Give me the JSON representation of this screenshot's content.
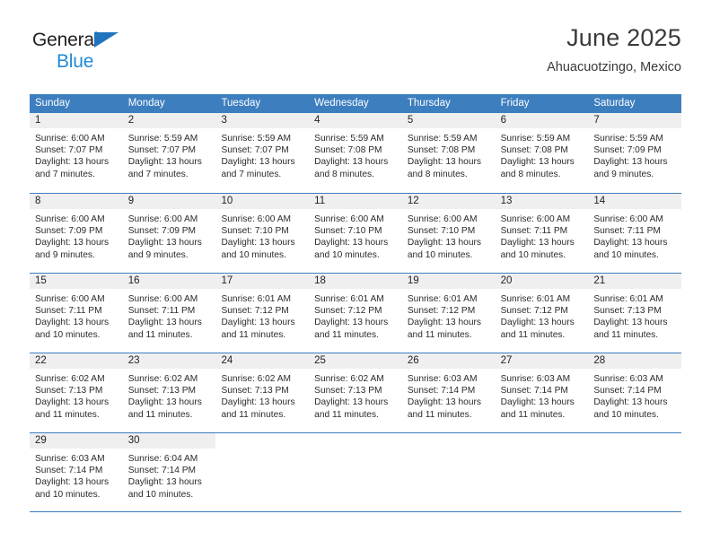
{
  "brand": {
    "line1": "General",
    "line2": "Blue",
    "triangle_color": "#1f74bd",
    "line2_color": "#1f8ad6"
  },
  "header": {
    "title": "June 2025",
    "subtitle": "Ahuacuotzingo, Mexico"
  },
  "theme": {
    "header_bg": "#3d7ebf",
    "header_text": "#ffffff",
    "daynum_bg": "#efefef",
    "grid_line": "#3d7ebf"
  },
  "weekdays": [
    "Sunday",
    "Monday",
    "Tuesday",
    "Wednesday",
    "Thursday",
    "Friday",
    "Saturday"
  ],
  "weeks": [
    [
      {
        "day": "1",
        "sunrise": "Sunrise: 6:00 AM",
        "sunset": "Sunset: 7:07 PM",
        "daylight1": "Daylight: 13 hours",
        "daylight2": "and 7 minutes."
      },
      {
        "day": "2",
        "sunrise": "Sunrise: 5:59 AM",
        "sunset": "Sunset: 7:07 PM",
        "daylight1": "Daylight: 13 hours",
        "daylight2": "and 7 minutes."
      },
      {
        "day": "3",
        "sunrise": "Sunrise: 5:59 AM",
        "sunset": "Sunset: 7:07 PM",
        "daylight1": "Daylight: 13 hours",
        "daylight2": "and 7 minutes."
      },
      {
        "day": "4",
        "sunrise": "Sunrise: 5:59 AM",
        "sunset": "Sunset: 7:08 PM",
        "daylight1": "Daylight: 13 hours",
        "daylight2": "and 8 minutes."
      },
      {
        "day": "5",
        "sunrise": "Sunrise: 5:59 AM",
        "sunset": "Sunset: 7:08 PM",
        "daylight1": "Daylight: 13 hours",
        "daylight2": "and 8 minutes."
      },
      {
        "day": "6",
        "sunrise": "Sunrise: 5:59 AM",
        "sunset": "Sunset: 7:08 PM",
        "daylight1": "Daylight: 13 hours",
        "daylight2": "and 8 minutes."
      },
      {
        "day": "7",
        "sunrise": "Sunrise: 5:59 AM",
        "sunset": "Sunset: 7:09 PM",
        "daylight1": "Daylight: 13 hours",
        "daylight2": "and 9 minutes."
      }
    ],
    [
      {
        "day": "8",
        "sunrise": "Sunrise: 6:00 AM",
        "sunset": "Sunset: 7:09 PM",
        "daylight1": "Daylight: 13 hours",
        "daylight2": "and 9 minutes."
      },
      {
        "day": "9",
        "sunrise": "Sunrise: 6:00 AM",
        "sunset": "Sunset: 7:09 PM",
        "daylight1": "Daylight: 13 hours",
        "daylight2": "and 9 minutes."
      },
      {
        "day": "10",
        "sunrise": "Sunrise: 6:00 AM",
        "sunset": "Sunset: 7:10 PM",
        "daylight1": "Daylight: 13 hours",
        "daylight2": "and 10 minutes."
      },
      {
        "day": "11",
        "sunrise": "Sunrise: 6:00 AM",
        "sunset": "Sunset: 7:10 PM",
        "daylight1": "Daylight: 13 hours",
        "daylight2": "and 10 minutes."
      },
      {
        "day": "12",
        "sunrise": "Sunrise: 6:00 AM",
        "sunset": "Sunset: 7:10 PM",
        "daylight1": "Daylight: 13 hours",
        "daylight2": "and 10 minutes."
      },
      {
        "day": "13",
        "sunrise": "Sunrise: 6:00 AM",
        "sunset": "Sunset: 7:11 PM",
        "daylight1": "Daylight: 13 hours",
        "daylight2": "and 10 minutes."
      },
      {
        "day": "14",
        "sunrise": "Sunrise: 6:00 AM",
        "sunset": "Sunset: 7:11 PM",
        "daylight1": "Daylight: 13 hours",
        "daylight2": "and 10 minutes."
      }
    ],
    [
      {
        "day": "15",
        "sunrise": "Sunrise: 6:00 AM",
        "sunset": "Sunset: 7:11 PM",
        "daylight1": "Daylight: 13 hours",
        "daylight2": "and 10 minutes."
      },
      {
        "day": "16",
        "sunrise": "Sunrise: 6:00 AM",
        "sunset": "Sunset: 7:11 PM",
        "daylight1": "Daylight: 13 hours",
        "daylight2": "and 11 minutes."
      },
      {
        "day": "17",
        "sunrise": "Sunrise: 6:01 AM",
        "sunset": "Sunset: 7:12 PM",
        "daylight1": "Daylight: 13 hours",
        "daylight2": "and 11 minutes."
      },
      {
        "day": "18",
        "sunrise": "Sunrise: 6:01 AM",
        "sunset": "Sunset: 7:12 PM",
        "daylight1": "Daylight: 13 hours",
        "daylight2": "and 11 minutes."
      },
      {
        "day": "19",
        "sunrise": "Sunrise: 6:01 AM",
        "sunset": "Sunset: 7:12 PM",
        "daylight1": "Daylight: 13 hours",
        "daylight2": "and 11 minutes."
      },
      {
        "day": "20",
        "sunrise": "Sunrise: 6:01 AM",
        "sunset": "Sunset: 7:12 PM",
        "daylight1": "Daylight: 13 hours",
        "daylight2": "and 11 minutes."
      },
      {
        "day": "21",
        "sunrise": "Sunrise: 6:01 AM",
        "sunset": "Sunset: 7:13 PM",
        "daylight1": "Daylight: 13 hours",
        "daylight2": "and 11 minutes."
      }
    ],
    [
      {
        "day": "22",
        "sunrise": "Sunrise: 6:02 AM",
        "sunset": "Sunset: 7:13 PM",
        "daylight1": "Daylight: 13 hours",
        "daylight2": "and 11 minutes."
      },
      {
        "day": "23",
        "sunrise": "Sunrise: 6:02 AM",
        "sunset": "Sunset: 7:13 PM",
        "daylight1": "Daylight: 13 hours",
        "daylight2": "and 11 minutes."
      },
      {
        "day": "24",
        "sunrise": "Sunrise: 6:02 AM",
        "sunset": "Sunset: 7:13 PM",
        "daylight1": "Daylight: 13 hours",
        "daylight2": "and 11 minutes."
      },
      {
        "day": "25",
        "sunrise": "Sunrise: 6:02 AM",
        "sunset": "Sunset: 7:13 PM",
        "daylight1": "Daylight: 13 hours",
        "daylight2": "and 11 minutes."
      },
      {
        "day": "26",
        "sunrise": "Sunrise: 6:03 AM",
        "sunset": "Sunset: 7:14 PM",
        "daylight1": "Daylight: 13 hours",
        "daylight2": "and 11 minutes."
      },
      {
        "day": "27",
        "sunrise": "Sunrise: 6:03 AM",
        "sunset": "Sunset: 7:14 PM",
        "daylight1": "Daylight: 13 hours",
        "daylight2": "and 11 minutes."
      },
      {
        "day": "28",
        "sunrise": "Sunrise: 6:03 AM",
        "sunset": "Sunset: 7:14 PM",
        "daylight1": "Daylight: 13 hours",
        "daylight2": "and 10 minutes."
      }
    ],
    [
      {
        "day": "29",
        "sunrise": "Sunrise: 6:03 AM",
        "sunset": "Sunset: 7:14 PM",
        "daylight1": "Daylight: 13 hours",
        "daylight2": "and 10 minutes."
      },
      {
        "day": "30",
        "sunrise": "Sunrise: 6:04 AM",
        "sunset": "Sunset: 7:14 PM",
        "daylight1": "Daylight: 13 hours",
        "daylight2": "and 10 minutes."
      },
      {
        "day": "",
        "sunrise": "",
        "sunset": "",
        "daylight1": "",
        "daylight2": ""
      },
      {
        "day": "",
        "sunrise": "",
        "sunset": "",
        "daylight1": "",
        "daylight2": ""
      },
      {
        "day": "",
        "sunrise": "",
        "sunset": "",
        "daylight1": "",
        "daylight2": ""
      },
      {
        "day": "",
        "sunrise": "",
        "sunset": "",
        "daylight1": "",
        "daylight2": ""
      },
      {
        "day": "",
        "sunrise": "",
        "sunset": "",
        "daylight1": "",
        "daylight2": ""
      }
    ]
  ]
}
